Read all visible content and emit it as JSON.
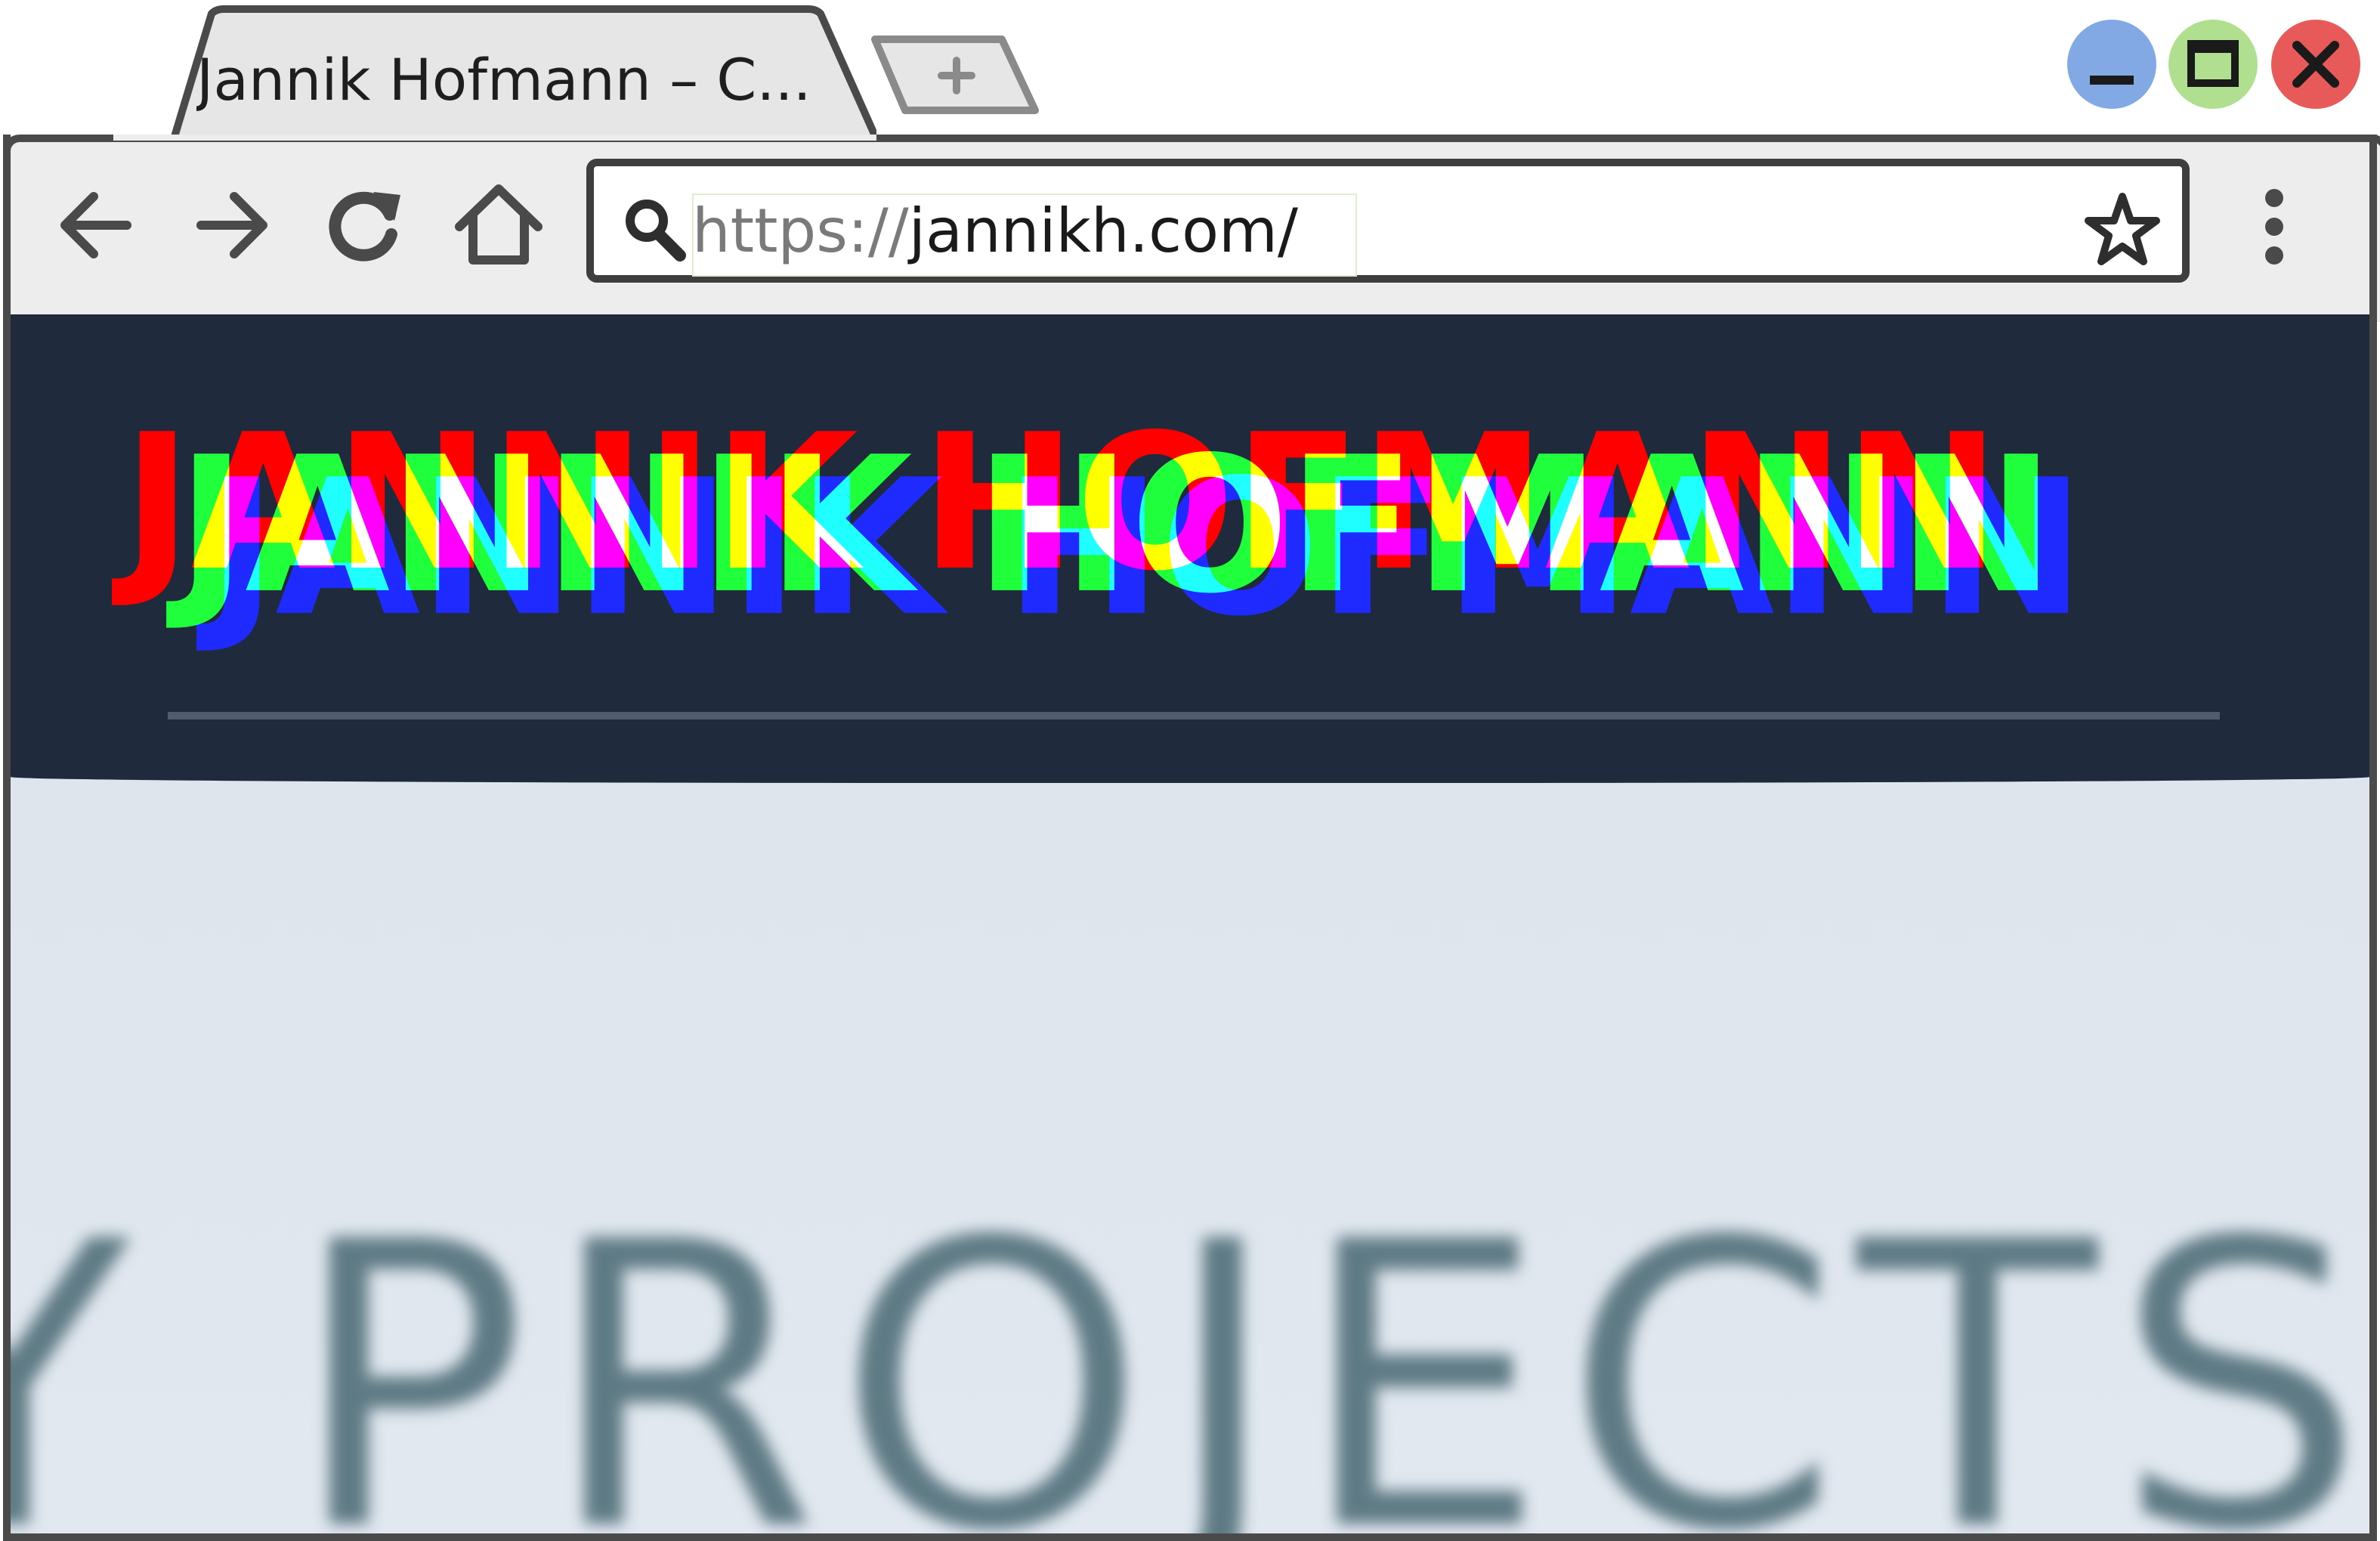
{
  "browser": {
    "tab_title": "Jannik Hofmann – C...",
    "address_scheme": "https://",
    "address_host": "jannikh.com/",
    "icons": {
      "back": "arrow-left-icon",
      "forward": "arrow-right-icon",
      "reload": "reload-icon",
      "home": "home-icon",
      "search": "search-icon",
      "bookmark": "star-icon",
      "menu": "kebab-menu-icon",
      "new_tab": "plus-icon",
      "minimize": "minimize-icon",
      "maximize": "maximize-icon",
      "close": "close-icon"
    },
    "colors": {
      "minimize": "#82a9e3",
      "maximize": "#b0e08f",
      "close": "#e85a5a"
    }
  },
  "page": {
    "header_title": "JANNIK HOFMANN",
    "section_heading": "Y PROJECTS",
    "colors": {
      "header_bg": "#1f2a3c",
      "glitch_red": "#ff0000",
      "glitch_green": "#00ff00",
      "glitch_blue": "#0000ff",
      "heading_text": "#5e7a84"
    }
  }
}
